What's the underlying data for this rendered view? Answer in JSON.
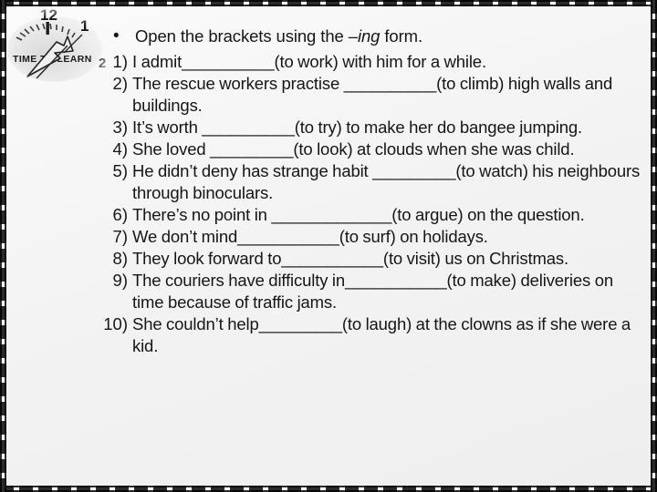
{
  "slide": {
    "background_color": "#f3f3f3",
    "border_color": "#2b2b2b",
    "text_color": "#161616"
  },
  "decoration": {
    "image_name": "clock-time-to-learn",
    "caption": "TIME TO LEARN",
    "numeral_12": "12",
    "numeral_1": "1",
    "numeral_2": "2"
  },
  "heading": {
    "bullet": "•",
    "before_italic": "Open the  brackets using the ",
    "italic": "–ing",
    "after_italic": " form."
  },
  "exercises": [
    {
      "number": "1)",
      "text": "I admit__________(to work) with him for a while."
    },
    {
      "number": "2)",
      "text": "The rescue workers practise __________(to climb) high walls and buildings."
    },
    {
      "number": "3)",
      "text": "It’s worth __________(to try) to make her do bangee jumping."
    },
    {
      "number": "4)",
      "text": "She loved _________(to look) at clouds when she was child."
    },
    {
      "number": "5)",
      "text": "He didn’t deny has strange habit _________(to watch) his neighbours through binoculars."
    },
    {
      "number": "6)",
      "text": "There’s no point in _____________(to argue) on the question."
    },
    {
      "number": "7)",
      "text": "We don’t mind___________(to surf) on holidays."
    },
    {
      "number": "8)",
      "text": "They look forward to___________(to visit) us on Christmas."
    },
    {
      "number": "9)",
      "text": "The  couriers have difficulty in___________(to make) deliveries on time because of traffic jams."
    },
    {
      "number": "10)",
      "text": "She couldn’t help_________(to laugh) at the clowns as if she were a kid."
    }
  ]
}
